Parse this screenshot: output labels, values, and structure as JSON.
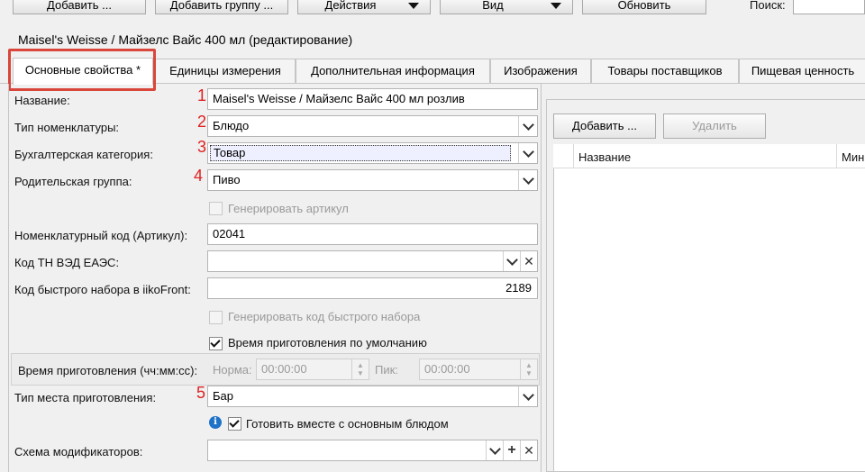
{
  "toolbar": {
    "add_label": "Добавить ...",
    "add_group_label": "Добавить группу ...",
    "actions_label": "Действия",
    "view_label": "Вид",
    "refresh_label": "Обновить",
    "search_label": "Поиск:"
  },
  "window_title": "Maisel's Weisse / Майзелс Вайс 400 мл (редактирование)",
  "tabs": [
    {
      "label": "Основные свойства *"
    },
    {
      "label": "Единицы измерения"
    },
    {
      "label": "Дополнительная информация"
    },
    {
      "label": "Изображения"
    },
    {
      "label": "Товары поставщиков"
    },
    {
      "label": "Пищевая ценность"
    }
  ],
  "form": {
    "name_label": "Название:",
    "name_value": "Maisel's Weisse / Майзелс Вайс 400 мл розлив",
    "type_label": "Тип номенклатуры:",
    "type_value": "Блюдо",
    "acc_label": "Бухгалтерская категория:",
    "acc_value": "Товар",
    "parent_label": "Родительская группа:",
    "parent_value": "Пиво",
    "gen_article_label": "Генерировать артикул",
    "code_label": "Номенклатурный код (Артикул):",
    "code_value": "02041",
    "tnved_label": "Код ТН ВЭД ЕАЭС:",
    "tnved_value": "",
    "fast_code_label": "Код быстрого набора в iikoFront:",
    "fast_code_value": "2189",
    "gen_fast_label": "Генерировать код быстрого набора",
    "default_time_label": "Время приготовления по умолчанию",
    "cook_time_label": "Время приготовления (чч:мм:сс):",
    "norm_label": "Норма:",
    "norm_value": "00:00:00",
    "peak_label": "Пик:",
    "peak_value": "00:00:00",
    "place_label": "Тип места приготовления:",
    "place_value": "Бар",
    "together_label": "Готовить вместе с основным блюдом",
    "modifiers_label": "Схема модификаторов:",
    "modifiers_value": ""
  },
  "markers": [
    "1",
    "2",
    "3",
    "4",
    "5"
  ],
  "right_panel": {
    "add_label": "Добавить ...",
    "delete_label": "Удалить",
    "col_name": "Название",
    "col_min": "Мин"
  },
  "colors": {
    "highlight_box": "#d9463b",
    "marker": "#d22222"
  }
}
